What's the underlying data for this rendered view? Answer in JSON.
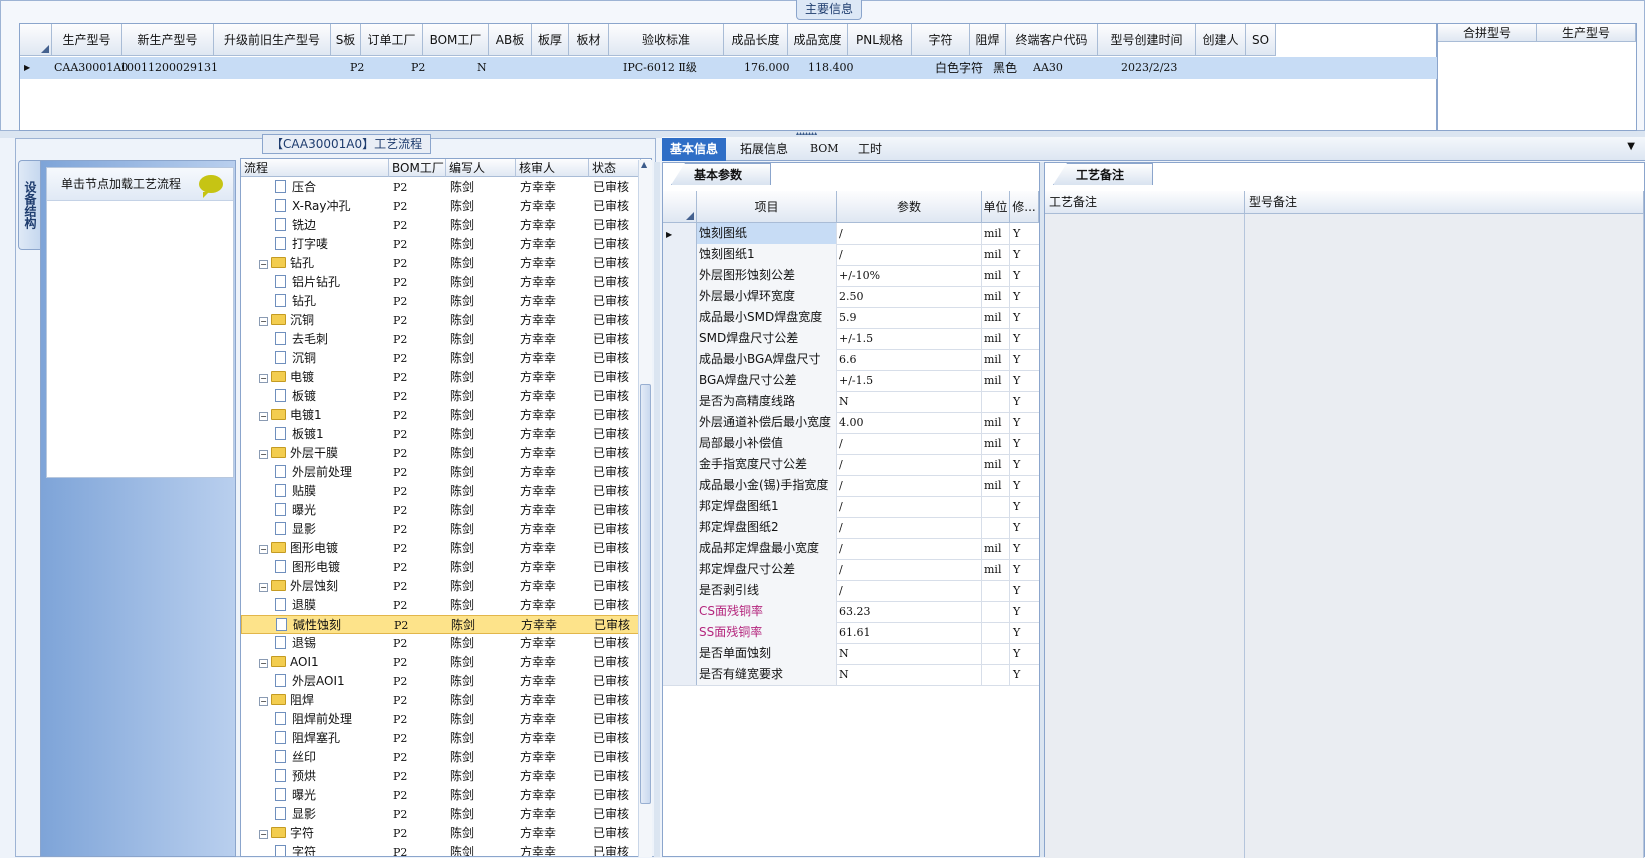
{
  "main": {
    "legend": "主要信息",
    "columns": [
      "生产型号",
      "新生产型号",
      "升级前旧生产型号",
      "S板",
      "订单工厂",
      "BOM工厂",
      "AB板",
      "板厚",
      "板材",
      "验收标准",
      "成品长度",
      "成品宽度",
      "PNL规格",
      "字符",
      "阻焊",
      "终端客户代码",
      "型号创建时间",
      "创建人",
      "SO"
    ],
    "row": {
      "prod_no": "CAA30001A0",
      "new_prod_no": "10011200029131",
      "order_factory": "P2",
      "bom_factory": "P2",
      "ab": "N",
      "standard": "IPC-6012 Ⅱ级",
      "length": "176.000",
      "width": "118.400",
      "char": "白色字符",
      "mask": "黑色",
      "customer": "AA30",
      "created": "2023/2/23"
    },
    "merge_columns": [
      "合拼型号",
      "生产型号"
    ]
  },
  "process": {
    "legend": "【CAA30001A0】工艺流程",
    "side_tab": "设备结构",
    "load_text": "单击节点加载工艺流程",
    "columns": [
      "流程",
      "BOM工厂",
      "编写人",
      "核审人",
      "状态"
    ],
    "rows": [
      {
        "name": "压合",
        "type": "doc",
        "level": 2,
        "bom": "P2",
        "writer": "陈剑",
        "reviewer": "方幸幸",
        "status": "已审核"
      },
      {
        "name": "X-Ray冲孔",
        "type": "doc",
        "level": 2,
        "bom": "P2",
        "writer": "陈剑",
        "reviewer": "方幸幸",
        "status": "已审核"
      },
      {
        "name": "铣边",
        "type": "doc",
        "level": 2,
        "bom": "P2",
        "writer": "陈剑",
        "reviewer": "方幸幸",
        "status": "已审核"
      },
      {
        "name": "打字唛",
        "type": "doc",
        "level": 2,
        "bom": "P2",
        "writer": "陈剑",
        "reviewer": "方幸幸",
        "status": "已审核"
      },
      {
        "name": "钻孔",
        "type": "folder",
        "level": 1,
        "bom": "P2",
        "writer": "陈剑",
        "reviewer": "方幸幸",
        "status": "已审核"
      },
      {
        "name": "铝片钻孔",
        "type": "doc",
        "level": 2,
        "bom": "P2",
        "writer": "陈剑",
        "reviewer": "方幸幸",
        "status": "已审核"
      },
      {
        "name": "钻孔",
        "type": "doc",
        "level": 2,
        "bom": "P2",
        "writer": "陈剑",
        "reviewer": "方幸幸",
        "status": "已审核"
      },
      {
        "name": "沉铜",
        "type": "folder",
        "level": 1,
        "bom": "P2",
        "writer": "陈剑",
        "reviewer": "方幸幸",
        "status": "已审核"
      },
      {
        "name": "去毛刺",
        "type": "doc",
        "level": 2,
        "bom": "P2",
        "writer": "陈剑",
        "reviewer": "方幸幸",
        "status": "已审核"
      },
      {
        "name": "沉铜",
        "type": "doc",
        "level": 2,
        "bom": "P2",
        "writer": "陈剑",
        "reviewer": "方幸幸",
        "status": "已审核"
      },
      {
        "name": "电镀",
        "type": "folder",
        "level": 1,
        "bom": "P2",
        "writer": "陈剑",
        "reviewer": "方幸幸",
        "status": "已审核"
      },
      {
        "name": "板镀",
        "type": "doc",
        "level": 2,
        "bom": "P2",
        "writer": "陈剑",
        "reviewer": "方幸幸",
        "status": "已审核"
      },
      {
        "name": "电镀1",
        "type": "folder",
        "level": 1,
        "bom": "P2",
        "writer": "陈剑",
        "reviewer": "方幸幸",
        "status": "已审核"
      },
      {
        "name": "板镀1",
        "type": "doc",
        "level": 2,
        "bom": "P2",
        "writer": "陈剑",
        "reviewer": "方幸幸",
        "status": "已审核"
      },
      {
        "name": "外层干膜",
        "type": "folder",
        "level": 1,
        "bom": "P2",
        "writer": "陈剑",
        "reviewer": "方幸幸",
        "status": "已审核"
      },
      {
        "name": "外层前处理",
        "type": "doc",
        "level": 2,
        "bom": "P2",
        "writer": "陈剑",
        "reviewer": "方幸幸",
        "status": "已审核"
      },
      {
        "name": "贴膜",
        "type": "doc",
        "level": 2,
        "bom": "P2",
        "writer": "陈剑",
        "reviewer": "方幸幸",
        "status": "已审核"
      },
      {
        "name": "曝光",
        "type": "doc",
        "level": 2,
        "bom": "P2",
        "writer": "陈剑",
        "reviewer": "方幸幸",
        "status": "已审核"
      },
      {
        "name": "显影",
        "type": "doc",
        "level": 2,
        "bom": "P2",
        "writer": "陈剑",
        "reviewer": "方幸幸",
        "status": "已审核"
      },
      {
        "name": "图形电镀",
        "type": "folder",
        "level": 1,
        "bom": "P2",
        "writer": "陈剑",
        "reviewer": "方幸幸",
        "status": "已审核"
      },
      {
        "name": "图形电镀",
        "type": "doc",
        "level": 2,
        "bom": "P2",
        "writer": "陈剑",
        "reviewer": "方幸幸",
        "status": "已审核"
      },
      {
        "name": "外层蚀刻",
        "type": "folder",
        "level": 1,
        "bom": "P2",
        "writer": "陈剑",
        "reviewer": "方幸幸",
        "status": "已审核"
      },
      {
        "name": "退膜",
        "type": "doc",
        "level": 2,
        "bom": "P2",
        "writer": "陈剑",
        "reviewer": "方幸幸",
        "status": "已审核"
      },
      {
        "name": "碱性蚀刻",
        "type": "doc",
        "level": 2,
        "bom": "P2",
        "writer": "陈剑",
        "reviewer": "方幸幸",
        "status": "已审核",
        "selected": true
      },
      {
        "name": "退锡",
        "type": "doc",
        "level": 2,
        "bom": "P2",
        "writer": "陈剑",
        "reviewer": "方幸幸",
        "status": "已审核"
      },
      {
        "name": "AOI1",
        "type": "folder",
        "level": 1,
        "bom": "P2",
        "writer": "陈剑",
        "reviewer": "方幸幸",
        "status": "已审核"
      },
      {
        "name": "外层AOI1",
        "type": "doc",
        "level": 2,
        "bom": "P2",
        "writer": "陈剑",
        "reviewer": "方幸幸",
        "status": "已审核"
      },
      {
        "name": "阻焊",
        "type": "folder",
        "level": 1,
        "bom": "P2",
        "writer": "陈剑",
        "reviewer": "方幸幸",
        "status": "已审核"
      },
      {
        "name": "阻焊前处理",
        "type": "doc",
        "level": 2,
        "bom": "P2",
        "writer": "陈剑",
        "reviewer": "方幸幸",
        "status": "已审核"
      },
      {
        "name": "阻焊塞孔",
        "type": "doc",
        "level": 2,
        "bom": "P2",
        "writer": "陈剑",
        "reviewer": "方幸幸",
        "status": "已审核"
      },
      {
        "name": "丝印",
        "type": "doc",
        "level": 2,
        "bom": "P2",
        "writer": "陈剑",
        "reviewer": "方幸幸",
        "status": "已审核"
      },
      {
        "name": "预烘",
        "type": "doc",
        "level": 2,
        "bom": "P2",
        "writer": "陈剑",
        "reviewer": "方幸幸",
        "status": "已审核"
      },
      {
        "name": "曝光",
        "type": "doc",
        "level": 2,
        "bom": "P2",
        "writer": "陈剑",
        "reviewer": "方幸幸",
        "status": "已审核"
      },
      {
        "name": "显影",
        "type": "doc",
        "level": 2,
        "bom": "P2",
        "writer": "陈剑",
        "reviewer": "方幸幸",
        "status": "已审核"
      },
      {
        "name": "字符",
        "type": "folder",
        "level": 1,
        "bom": "P2",
        "writer": "陈剑",
        "reviewer": "方幸幸",
        "status": "已审核"
      },
      {
        "name": "字符",
        "type": "doc",
        "level": 2,
        "bom": "P2",
        "writer": "陈剑",
        "reviewer": "方幸幸",
        "status": "已审核"
      }
    ]
  },
  "detail": {
    "tabs": [
      "基本信息",
      "拓展信息",
      "BOM",
      "工时"
    ],
    "basic_tab": "基本参数",
    "columns": [
      "项目",
      "参数",
      "单位",
      "修..."
    ],
    "params": [
      {
        "item": "蚀刻图纸",
        "value": "/",
        "unit": "mil",
        "mod": "Y",
        "current": true
      },
      {
        "item": "蚀刻图纸1",
        "value": "/",
        "unit": "mil",
        "mod": "Y"
      },
      {
        "item": "外层图形蚀刻公差",
        "value": "+/-10%",
        "unit": "mil",
        "mod": "Y"
      },
      {
        "item": "外层最小焊环宽度",
        "value": "2.50",
        "unit": "mil",
        "mod": "Y"
      },
      {
        "item": "成品最小SMD焊盘宽度",
        "value": "5.9",
        "unit": "mil",
        "mod": "Y"
      },
      {
        "item": "SMD焊盘尺寸公差",
        "value": "+/-1.5",
        "unit": "mil",
        "mod": "Y"
      },
      {
        "item": "成品最小BGA焊盘尺寸",
        "value": "6.6",
        "unit": "mil",
        "mod": "Y"
      },
      {
        "item": "BGA焊盘尺寸公差",
        "value": "+/-1.5",
        "unit": "mil",
        "mod": "Y"
      },
      {
        "item": "是否为高精度线路",
        "value": "N",
        "unit": "",
        "mod": "Y"
      },
      {
        "item": "外层通道补偿后最小宽度",
        "value": "4.00",
        "unit": "mil",
        "mod": "Y"
      },
      {
        "item": "局部最小补偿值",
        "value": "/",
        "unit": "mil",
        "mod": "Y"
      },
      {
        "item": "金手指宽度尺寸公差",
        "value": "/",
        "unit": "mil",
        "mod": "Y"
      },
      {
        "item": "成品最小金(锡)手指宽度",
        "value": "/",
        "unit": "mil",
        "mod": "Y"
      },
      {
        "item": "邦定焊盘图纸1",
        "value": "/",
        "unit": "",
        "mod": "Y"
      },
      {
        "item": "邦定焊盘图纸2",
        "value": "/",
        "unit": "",
        "mod": "Y"
      },
      {
        "item": "成品邦定焊盘最小宽度",
        "value": "/",
        "unit": "mil",
        "mod": "Y"
      },
      {
        "item": "邦定焊盘尺寸公差",
        "value": "/",
        "unit": "mil",
        "mod": "Y"
      },
      {
        "item": "是否剥引线",
        "value": "/",
        "unit": "",
        "mod": "Y"
      },
      {
        "item": "CS面残铜率",
        "value": "63.23",
        "unit": "",
        "mod": "Y",
        "highlight": true
      },
      {
        "item": "SS面残铜率",
        "value": "61.61",
        "unit": "",
        "mod": "Y",
        "highlight": true
      },
      {
        "item": "是否单面蚀刻",
        "value": "N",
        "unit": "",
        "mod": "Y"
      },
      {
        "item": "是否有缝宽要求",
        "value": "N",
        "unit": "",
        "mod": "Y"
      }
    ],
    "remark_tab": "工艺备注",
    "remark_columns": [
      "工艺备注",
      "型号备注"
    ]
  }
}
